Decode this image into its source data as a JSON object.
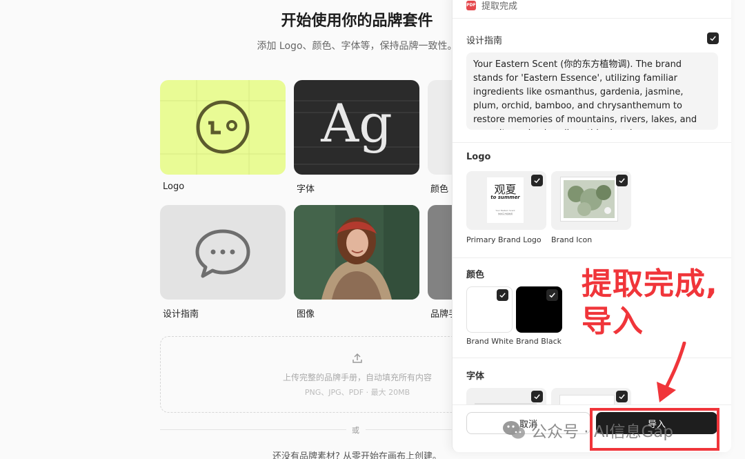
{
  "page": {
    "title": "开始使用你的品牌套件",
    "subtitle": "添加 Logo、颜色、字体等，保持品牌一致性。",
    "cards": {
      "logo": "Logo",
      "font": "字体",
      "color": "颜色",
      "guide": "设计指南",
      "image": "图像",
      "manual": "品牌手"
    },
    "font_sample": "Ag",
    "upload": {
      "text": "上传完整的品牌手册，自动填充所有内容",
      "hint": "PNG、JPG、PDF · 最大 20MB"
    },
    "or": "或",
    "bottom": "还没有品牌素材? 从零开始在画布上创建。"
  },
  "panel": {
    "status": "提取完成",
    "pdf_label": "PDF",
    "guide": {
      "title": "设计指南",
      "text": "Your Eastern Scent (你的东方植物调). The brand stands for 'Eastern Essence', utilizing familiar ingredients like osmanthus, gardenia, jasmine, plum, orchid, bamboo, and chrysanthemum to restore memories of mountains, rivers, lakes, and seas. It emphasizes 'breathing' and..."
    },
    "logo": {
      "title": "Logo",
      "items": [
        {
          "label": "Primary Brand Logo",
          "mark_cn": "观夏",
          "mark_en": "to summer",
          "mark_small1": "Your Eastern Scent",
          "mark_small2": "你的东方植物调"
        },
        {
          "label": "Brand Icon"
        }
      ]
    },
    "colors": {
      "title": "颜色",
      "items": [
        {
          "label": "Brand White",
          "hex": "#ffffff"
        },
        {
          "label": "Brand Black",
          "hex": "#000000"
        }
      ]
    },
    "fonts": {
      "title": "字体"
    },
    "footer": {
      "cancel": "取消",
      "import": "导入"
    }
  },
  "annotation": {
    "line1": "提取完成,",
    "line2": "导入",
    "color": "#f0353a"
  },
  "watermark": "公众号 · AI信息Gap"
}
